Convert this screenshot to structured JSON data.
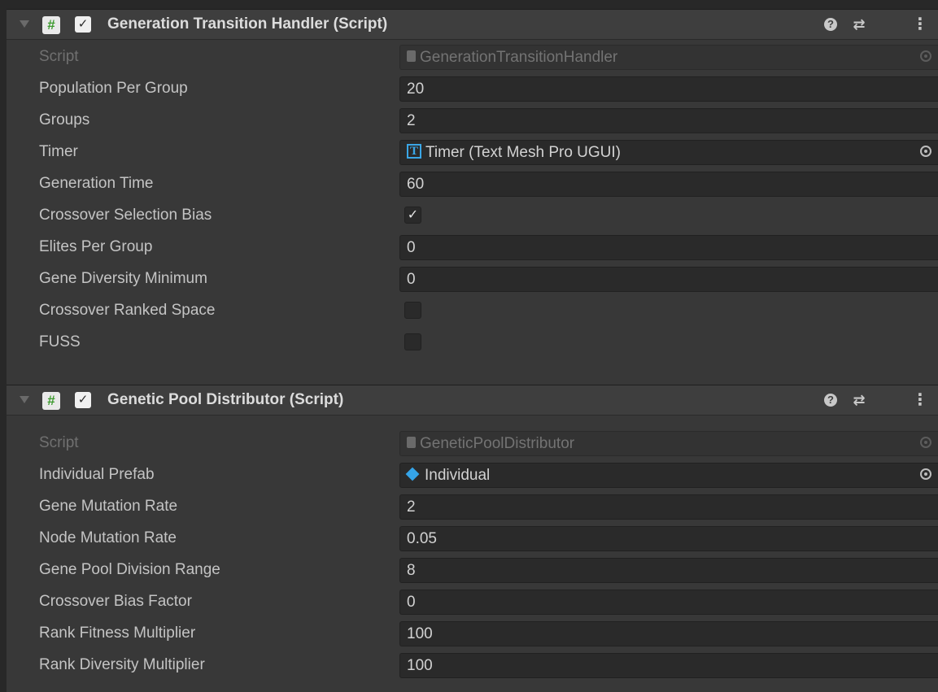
{
  "components": [
    {
      "title": "Generation Transition Handler (Script)",
      "enabled_mark": "✓",
      "script_icon": "#",
      "help_icon": "?",
      "preset_icon": "⇄",
      "menu_icon": "⋮",
      "script_label": "Script",
      "script_value": "GenerationTransitionHandler",
      "fields": [
        {
          "label": "Population Per Group",
          "value": "20"
        },
        {
          "label": "Groups",
          "value": "2"
        },
        {
          "label": "Timer",
          "value": "Timer (Text Mesh Pro UGUI)",
          "icon": "T"
        },
        {
          "label": "Generation Time",
          "value": "60"
        },
        {
          "label": "Crossover Selection Bias",
          "checked": true,
          "mark": "✓"
        },
        {
          "label": "Elites Per Group",
          "value": "0"
        },
        {
          "label": "Gene Diversity Minimum",
          "value": "0"
        },
        {
          "label": "Crossover Ranked Space",
          "checked": false,
          "mark": ""
        },
        {
          "label": "FUSS",
          "checked": false,
          "mark": ""
        }
      ]
    },
    {
      "title": "Genetic Pool Distributor (Script)",
      "enabled_mark": "✓",
      "script_icon": "#",
      "help_icon": "?",
      "preset_icon": "⇄",
      "menu_icon": "⋮",
      "script_label": "Script",
      "script_value": "GeneticPoolDistributor",
      "fields": [
        {
          "label": "Individual Prefab",
          "value": "Individual"
        },
        {
          "label": "Gene Mutation Rate",
          "value": "2"
        },
        {
          "label": "Node Mutation Rate",
          "value": "0.05"
        },
        {
          "label": "Gene Pool Division Range",
          "value": "8"
        },
        {
          "label": "Crossover Bias Factor",
          "value": "0"
        },
        {
          "label": "Rank Fitness Multiplier",
          "value": "100"
        },
        {
          "label": "Rank Diversity Multiplier",
          "value": "100"
        }
      ]
    }
  ],
  "colors": {
    "background": "#383838",
    "header": "#3e3e3e",
    "field": "#2a2a2a",
    "script_icon_green": "#3c9a2e",
    "tmp_icon_blue": "#3aa6e6",
    "prefab_icon_blue": "#35a4e8"
  }
}
